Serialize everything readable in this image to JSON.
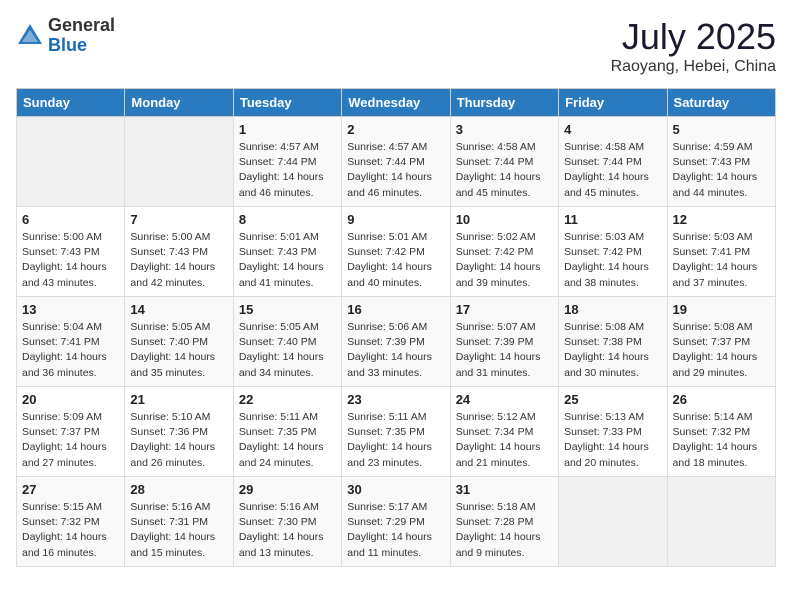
{
  "header": {
    "logo_general": "General",
    "logo_blue": "Blue",
    "month": "July 2025",
    "location": "Raoyang, Hebei, China"
  },
  "days_of_week": [
    "Sunday",
    "Monday",
    "Tuesday",
    "Wednesday",
    "Thursday",
    "Friday",
    "Saturday"
  ],
  "weeks": [
    [
      {
        "day": "",
        "empty": true
      },
      {
        "day": "",
        "empty": true
      },
      {
        "day": "1",
        "sunrise": "Sunrise: 4:57 AM",
        "sunset": "Sunset: 7:44 PM",
        "daylight": "Daylight: 14 hours and 46 minutes."
      },
      {
        "day": "2",
        "sunrise": "Sunrise: 4:57 AM",
        "sunset": "Sunset: 7:44 PM",
        "daylight": "Daylight: 14 hours and 46 minutes."
      },
      {
        "day": "3",
        "sunrise": "Sunrise: 4:58 AM",
        "sunset": "Sunset: 7:44 PM",
        "daylight": "Daylight: 14 hours and 45 minutes."
      },
      {
        "day": "4",
        "sunrise": "Sunrise: 4:58 AM",
        "sunset": "Sunset: 7:44 PM",
        "daylight": "Daylight: 14 hours and 45 minutes."
      },
      {
        "day": "5",
        "sunrise": "Sunrise: 4:59 AM",
        "sunset": "Sunset: 7:43 PM",
        "daylight": "Daylight: 14 hours and 44 minutes."
      }
    ],
    [
      {
        "day": "6",
        "sunrise": "Sunrise: 5:00 AM",
        "sunset": "Sunset: 7:43 PM",
        "daylight": "Daylight: 14 hours and 43 minutes."
      },
      {
        "day": "7",
        "sunrise": "Sunrise: 5:00 AM",
        "sunset": "Sunset: 7:43 PM",
        "daylight": "Daylight: 14 hours and 42 minutes."
      },
      {
        "day": "8",
        "sunrise": "Sunrise: 5:01 AM",
        "sunset": "Sunset: 7:43 PM",
        "daylight": "Daylight: 14 hours and 41 minutes."
      },
      {
        "day": "9",
        "sunrise": "Sunrise: 5:01 AM",
        "sunset": "Sunset: 7:42 PM",
        "daylight": "Daylight: 14 hours and 40 minutes."
      },
      {
        "day": "10",
        "sunrise": "Sunrise: 5:02 AM",
        "sunset": "Sunset: 7:42 PM",
        "daylight": "Daylight: 14 hours and 39 minutes."
      },
      {
        "day": "11",
        "sunrise": "Sunrise: 5:03 AM",
        "sunset": "Sunset: 7:42 PM",
        "daylight": "Daylight: 14 hours and 38 minutes."
      },
      {
        "day": "12",
        "sunrise": "Sunrise: 5:03 AM",
        "sunset": "Sunset: 7:41 PM",
        "daylight": "Daylight: 14 hours and 37 minutes."
      }
    ],
    [
      {
        "day": "13",
        "sunrise": "Sunrise: 5:04 AM",
        "sunset": "Sunset: 7:41 PM",
        "daylight": "Daylight: 14 hours and 36 minutes."
      },
      {
        "day": "14",
        "sunrise": "Sunrise: 5:05 AM",
        "sunset": "Sunset: 7:40 PM",
        "daylight": "Daylight: 14 hours and 35 minutes."
      },
      {
        "day": "15",
        "sunrise": "Sunrise: 5:05 AM",
        "sunset": "Sunset: 7:40 PM",
        "daylight": "Daylight: 14 hours and 34 minutes."
      },
      {
        "day": "16",
        "sunrise": "Sunrise: 5:06 AM",
        "sunset": "Sunset: 7:39 PM",
        "daylight": "Daylight: 14 hours and 33 minutes."
      },
      {
        "day": "17",
        "sunrise": "Sunrise: 5:07 AM",
        "sunset": "Sunset: 7:39 PM",
        "daylight": "Daylight: 14 hours and 31 minutes."
      },
      {
        "day": "18",
        "sunrise": "Sunrise: 5:08 AM",
        "sunset": "Sunset: 7:38 PM",
        "daylight": "Daylight: 14 hours and 30 minutes."
      },
      {
        "day": "19",
        "sunrise": "Sunrise: 5:08 AM",
        "sunset": "Sunset: 7:37 PM",
        "daylight": "Daylight: 14 hours and 29 minutes."
      }
    ],
    [
      {
        "day": "20",
        "sunrise": "Sunrise: 5:09 AM",
        "sunset": "Sunset: 7:37 PM",
        "daylight": "Daylight: 14 hours and 27 minutes."
      },
      {
        "day": "21",
        "sunrise": "Sunrise: 5:10 AM",
        "sunset": "Sunset: 7:36 PM",
        "daylight": "Daylight: 14 hours and 26 minutes."
      },
      {
        "day": "22",
        "sunrise": "Sunrise: 5:11 AM",
        "sunset": "Sunset: 7:35 PM",
        "daylight": "Daylight: 14 hours and 24 minutes."
      },
      {
        "day": "23",
        "sunrise": "Sunrise: 5:11 AM",
        "sunset": "Sunset: 7:35 PM",
        "daylight": "Daylight: 14 hours and 23 minutes."
      },
      {
        "day": "24",
        "sunrise": "Sunrise: 5:12 AM",
        "sunset": "Sunset: 7:34 PM",
        "daylight": "Daylight: 14 hours and 21 minutes."
      },
      {
        "day": "25",
        "sunrise": "Sunrise: 5:13 AM",
        "sunset": "Sunset: 7:33 PM",
        "daylight": "Daylight: 14 hours and 20 minutes."
      },
      {
        "day": "26",
        "sunrise": "Sunrise: 5:14 AM",
        "sunset": "Sunset: 7:32 PM",
        "daylight": "Daylight: 14 hours and 18 minutes."
      }
    ],
    [
      {
        "day": "27",
        "sunrise": "Sunrise: 5:15 AM",
        "sunset": "Sunset: 7:32 PM",
        "daylight": "Daylight: 14 hours and 16 minutes."
      },
      {
        "day": "28",
        "sunrise": "Sunrise: 5:16 AM",
        "sunset": "Sunset: 7:31 PM",
        "daylight": "Daylight: 14 hours and 15 minutes."
      },
      {
        "day": "29",
        "sunrise": "Sunrise: 5:16 AM",
        "sunset": "Sunset: 7:30 PM",
        "daylight": "Daylight: 14 hours and 13 minutes."
      },
      {
        "day": "30",
        "sunrise": "Sunrise: 5:17 AM",
        "sunset": "Sunset: 7:29 PM",
        "daylight": "Daylight: 14 hours and 11 minutes."
      },
      {
        "day": "31",
        "sunrise": "Sunrise: 5:18 AM",
        "sunset": "Sunset: 7:28 PM",
        "daylight": "Daylight: 14 hours and 9 minutes."
      },
      {
        "day": "",
        "empty": true
      },
      {
        "day": "",
        "empty": true
      }
    ]
  ]
}
